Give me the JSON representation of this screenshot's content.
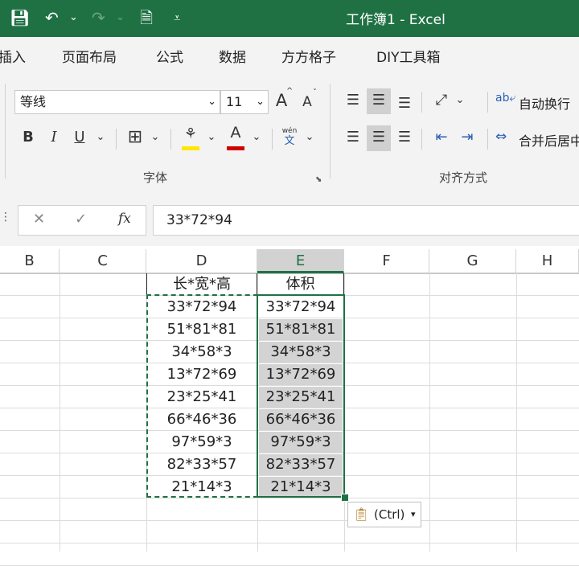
{
  "window": {
    "title": "工作簿1  -  Excel"
  },
  "menu": [
    "插入",
    "页面布局",
    "公式",
    "数据",
    "方方格子",
    "DIY工具箱"
  ],
  "ribbon": {
    "font_name": "等线",
    "font_size": "11",
    "bold": "B",
    "italic": "I",
    "underline": "U",
    "grow_font": "A",
    "shrink_font": "A",
    "font_color_letter": "A",
    "wen": "wén",
    "wen_char": "文",
    "wrap_text": "自动换行",
    "merge_center": "合并后居中",
    "font_group_label": "字体",
    "align_group_label": "对齐方式"
  },
  "formula_bar": {
    "fx": "fx",
    "content": "33*72*94"
  },
  "columns": [
    "B",
    "C",
    "D",
    "E",
    "F",
    "G",
    "H"
  ],
  "selected_column": "E",
  "sheet": {
    "header_d": "长*宽*高",
    "header_e": "体积",
    "rows": [
      {
        "d": "33*72*94",
        "e": "33*72*94"
      },
      {
        "d": "51*81*81",
        "e": "51*81*81"
      },
      {
        "d": "34*58*3",
        "e": "34*58*3"
      },
      {
        "d": "13*72*69",
        "e": "13*72*69"
      },
      {
        "d": "23*25*41",
        "e": "23*25*41"
      },
      {
        "d": "66*46*36",
        "e": "66*46*36"
      },
      {
        "d": "97*59*3",
        "e": "97*59*3"
      },
      {
        "d": "82*33*57",
        "e": "82*33*57"
      },
      {
        "d": "21*14*3",
        "e": "21*14*3"
      }
    ]
  },
  "paste_options": {
    "label": "(Ctrl)"
  },
  "colors": {
    "excel_green": "#1f7144",
    "font_color": "#d00000",
    "highlight": "#ffe600"
  }
}
